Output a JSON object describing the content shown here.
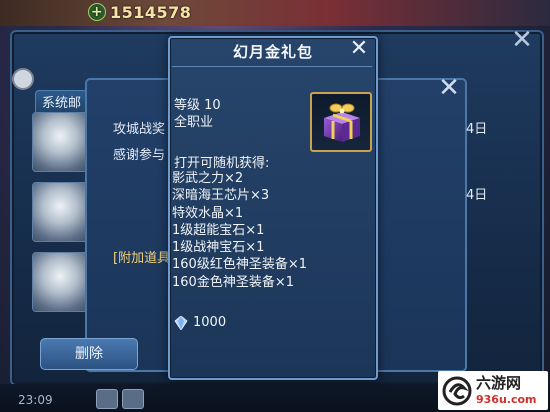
{
  "top_bar": {
    "gold_amount": "1514578"
  },
  "system_mail": {
    "tab_label": "系统邮",
    "line1": "攻城战奖",
    "line2": "感谢参与",
    "attachments_label": "[附加道具",
    "date_suffix_1": "4日",
    "date_suffix_2": "4日",
    "delete_button": "删除"
  },
  "popup": {
    "title": "幻月金礼包",
    "close_symbol": "✕",
    "level_text": "等级 10",
    "class_text": "全职业",
    "random_header": "打开可随机获得:",
    "rewards": [
      "影武之力×2",
      "深暗海王芯片×3",
      "特效水晶×1",
      "1级超能宝石×1",
      "1级战神宝石×1",
      "160级红色神圣装备×1",
      "160金色神圣装备×1"
    ],
    "crystal_price": "1000"
  },
  "status_bar": {
    "clock": "23:09"
  },
  "watermark": {
    "brand": "六游网",
    "url": "936u.com"
  },
  "colors": {
    "popup_bg": "#27456b",
    "popup_border": "#6f9bcd",
    "item_frame_gold": "#c8a24c",
    "gift_box_purple": "#6a2fa0"
  }
}
